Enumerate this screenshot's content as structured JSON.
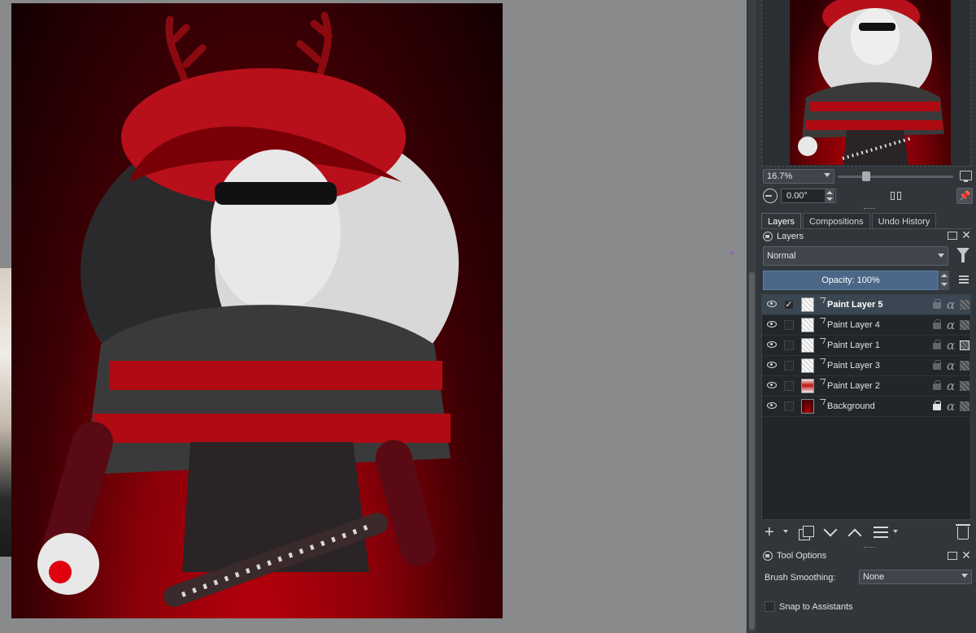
{
  "overview": {
    "zoom": "16.7%",
    "rotation": "0.00°"
  },
  "tabs": [
    {
      "label": "Layers",
      "active": true
    },
    {
      "label": "Compositions",
      "active": false
    },
    {
      "label": "Undo History",
      "active": false
    }
  ],
  "layers_panel": {
    "title": "Layers",
    "blend_mode": "Normal",
    "opacity": "Opacity: 100%",
    "layers": [
      {
        "name": "Paint Layer 5",
        "selected": true,
        "visible": true,
        "checked": true,
        "locked": false
      },
      {
        "name": "Paint Layer 4",
        "selected": false,
        "visible": true,
        "checked": false,
        "locked": false
      },
      {
        "name": "Paint Layer 1",
        "selected": false,
        "visible": true,
        "checked": false,
        "locked": false
      },
      {
        "name": "Paint Layer 3",
        "selected": false,
        "visible": true,
        "checked": false,
        "locked": false
      },
      {
        "name": "Paint Layer 2",
        "selected": false,
        "visible": true,
        "checked": false,
        "locked": false
      },
      {
        "name": "Background",
        "selected": false,
        "visible": true,
        "checked": false,
        "locked": true
      }
    ]
  },
  "tool_options": {
    "title": "Tool Options",
    "brush_smoothing_label": "Brush Smoothing:",
    "brush_smoothing_value": "None",
    "snap_label": "Snap to Assistants"
  },
  "icons": {
    "visibility": "eye-icon",
    "lock": "lock-icon",
    "alpha": "alpha-lock-icon",
    "inherit": "inherit-alpha-icon"
  },
  "colors": {
    "accent": "#4a6787",
    "canvas_bg": "#888a8c",
    "docker_bg": "#31363b"
  }
}
